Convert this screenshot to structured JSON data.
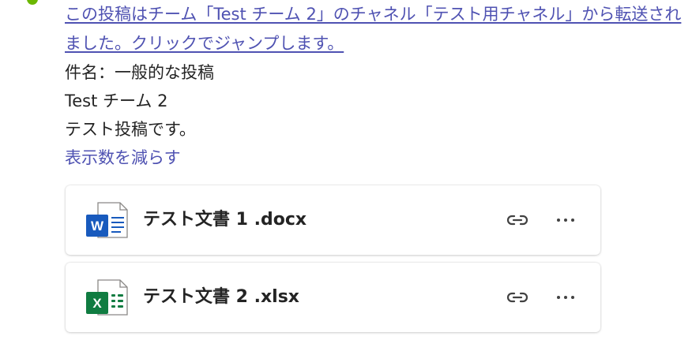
{
  "message": {
    "forward_notice": "この投稿はチーム「Test チーム 2」のチャネル「テスト用チャネル」から転送されました。クリックでジャンプします。",
    "subject_line": "件名：一般的な投稿",
    "team_line": "Test チーム 2",
    "body_line": "テスト投稿です。",
    "show_less_label": "表示数を減らす"
  },
  "attachments": [
    {
      "file_name": "テスト文書 1 .docx",
      "icon": "word-file-icon",
      "accent": "#185abd"
    },
    {
      "file_name": "テスト文書 2 .xlsx",
      "icon": "excel-file-icon",
      "accent": "#107c41"
    }
  ],
  "colors": {
    "link": "#4f52b2",
    "text": "#242424",
    "word": "#185abd",
    "excel": "#107c41"
  }
}
